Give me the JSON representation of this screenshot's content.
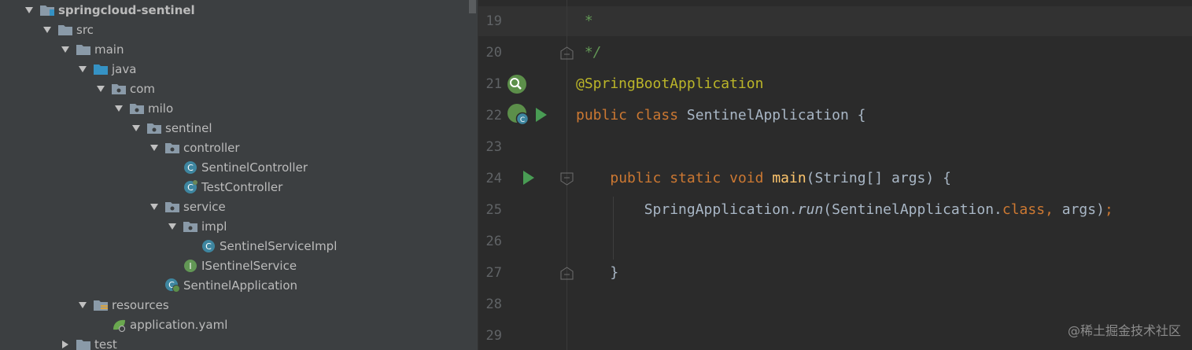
{
  "project_tree": {
    "items": [
      {
        "label": "springcloud-sentinel",
        "icon": "module-folder-icon",
        "expanded": true
      },
      {
        "label": "src",
        "icon": "folder-icon",
        "expanded": true
      },
      {
        "label": "main",
        "icon": "folder-icon",
        "expanded": true
      },
      {
        "label": "java",
        "icon": "source-root-folder-icon",
        "expanded": true
      },
      {
        "label": "com",
        "icon": "package-icon",
        "expanded": true
      },
      {
        "label": "milo",
        "icon": "package-icon",
        "expanded": true
      },
      {
        "label": "sentinel",
        "icon": "package-icon",
        "expanded": true
      },
      {
        "label": "controller",
        "icon": "package-icon",
        "expanded": true
      },
      {
        "label": "SentinelController",
        "icon": "class-icon"
      },
      {
        "label": "TestController",
        "icon": "class-icon"
      },
      {
        "label": "service",
        "icon": "package-icon",
        "expanded": true
      },
      {
        "label": "impl",
        "icon": "package-icon",
        "expanded": true
      },
      {
        "label": "SentinelServiceImpl",
        "icon": "class-icon"
      },
      {
        "label": "ISentinelService",
        "icon": "interface-icon"
      },
      {
        "label": "SentinelApplication",
        "icon": "spring-boot-class-icon"
      },
      {
        "label": "resources",
        "icon": "resources-folder-icon",
        "expanded": true
      },
      {
        "label": "application.yaml",
        "icon": "spring-yaml-icon"
      },
      {
        "label": "test",
        "icon": "folder-icon",
        "expanded": false
      }
    ]
  },
  "editor": {
    "line_numbers": [
      "19",
      "20",
      "21",
      "22",
      "23",
      "24",
      "25",
      "26",
      "27",
      "28",
      "29"
    ],
    "code": {
      "line19": " *",
      "line20": " */",
      "line21_annotation": "@SpringBootApplication",
      "line22_kw1": "public",
      "line22_kw2": "class",
      "line22_rest": "SentinelApplication {",
      "line24_kw1": "public",
      "line24_kw2": "static",
      "line24_kw3": "void",
      "line24_fn": "main",
      "line24_rest": "(String[] args) {",
      "line25_a": "SpringApplication.",
      "line25_run": "run",
      "line25_b": "(SentinelApplication.",
      "line25_class": "class",
      "line25_comma": ",",
      "line25_c": " args)",
      "line25_semi": ";",
      "line27": "}"
    }
  },
  "watermark": "@稀土掘金技术社区",
  "colors": {
    "tree_bg": "#3c3f41",
    "editor_bg": "#2b2b2b",
    "keyword": "#cc7832",
    "annotation": "#bbb529",
    "comment": "#629755",
    "method": "#ffc66d",
    "text": "#a9b7c6",
    "run_green": "#499c54"
  }
}
